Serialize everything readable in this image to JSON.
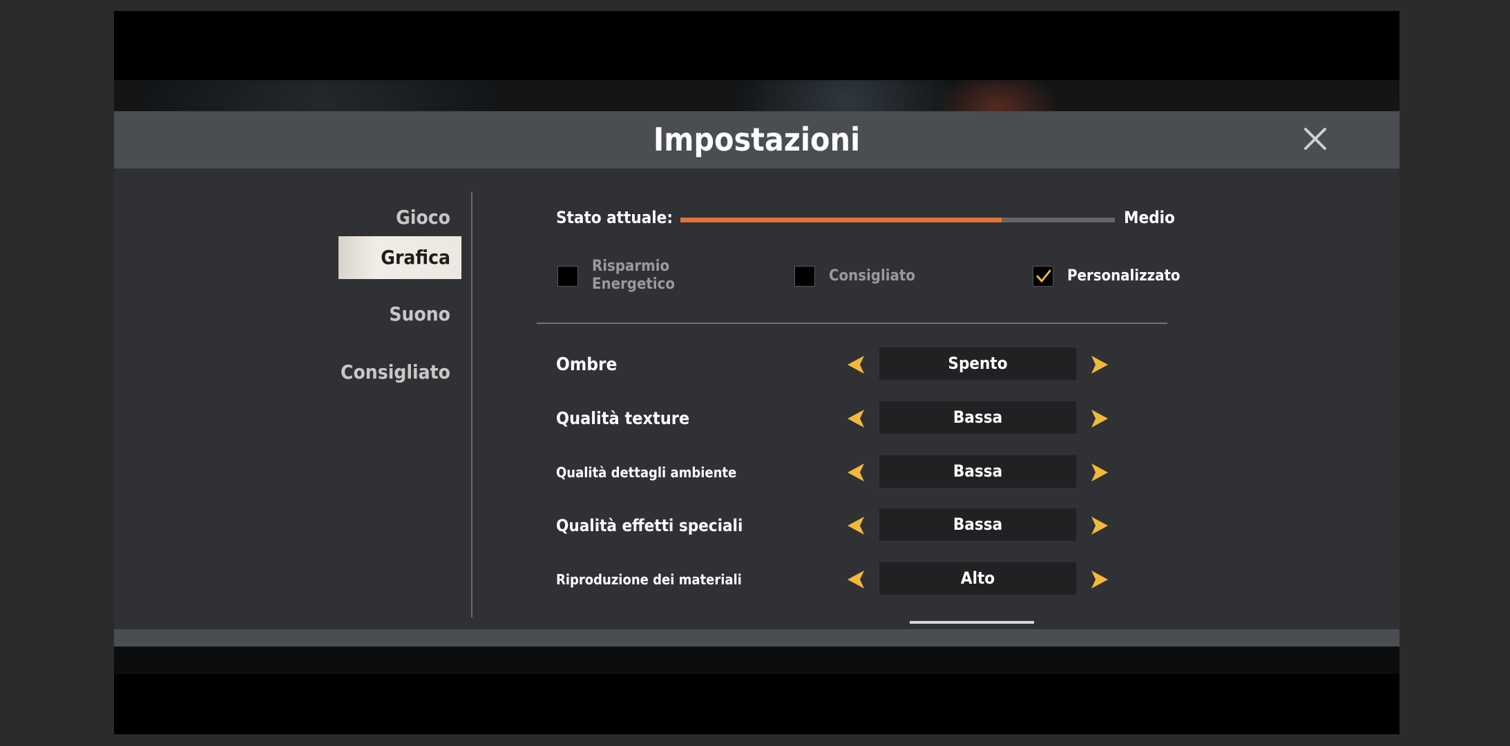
{
  "dialog": {
    "title": "Impostazioni"
  },
  "nav": {
    "items": [
      {
        "label": "Gioco"
      },
      {
        "label": "Grafica"
      },
      {
        "label": "Suono"
      },
      {
        "label": "Consigliato"
      }
    ],
    "active_index": 1
  },
  "quality": {
    "label": "Stato attuale:",
    "value": "Medio",
    "level_fraction": 0.74,
    "fill_color": "#e3733a"
  },
  "presets": [
    {
      "line1": "Risparmio",
      "line2": "Energetico",
      "checked": false
    },
    {
      "label": "Consigliato",
      "checked": false
    },
    {
      "label": "Personalizzato",
      "checked": true
    }
  ],
  "settings": [
    {
      "label": "Ombre",
      "value": "Spento"
    },
    {
      "label": "Qualità texture",
      "value": "Bassa"
    },
    {
      "label": "Qualità dettagli ambiente",
      "value": "Bassa"
    },
    {
      "label": "Qualità effetti speciali",
      "value": "Bassa"
    },
    {
      "label": "Riproduzione dei materiali",
      "value": "Alto"
    }
  ],
  "icons": {
    "close": "close-icon",
    "arrow_left": "chevron-left-icon",
    "arrow_right": "chevron-right-icon",
    "check": "checkmark-icon"
  },
  "colors": {
    "accent": "#e3733a",
    "arrow": "#f4b93a"
  }
}
